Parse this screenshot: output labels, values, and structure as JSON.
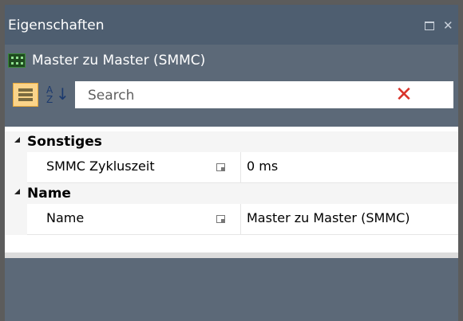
{
  "window": {
    "title": "Eigenschaften",
    "buttons": {
      "maximize_icon": "maximize-icon",
      "close_glyph": "✕"
    }
  },
  "object": {
    "icon": "network-object-icon",
    "label": "Master zu Master (SMMC)"
  },
  "toolbar": {
    "categorized_icon": "categorized-view-icon",
    "alphabetical_icon": "sort-az-icon",
    "alpha_top": "A",
    "alpha_bottom": "Z",
    "alpha_arrow": "↓",
    "search_placeholder": "Search",
    "clear_glyph": "✕"
  },
  "categories": [
    {
      "label": "Sonstiges",
      "properties": [
        {
          "name": "SMMC Zykluszeit",
          "value": "0 ms"
        }
      ]
    },
    {
      "label": "Name",
      "properties": [
        {
          "name": "Name",
          "value": "Master zu Master (SMMC)"
        }
      ]
    }
  ]
}
